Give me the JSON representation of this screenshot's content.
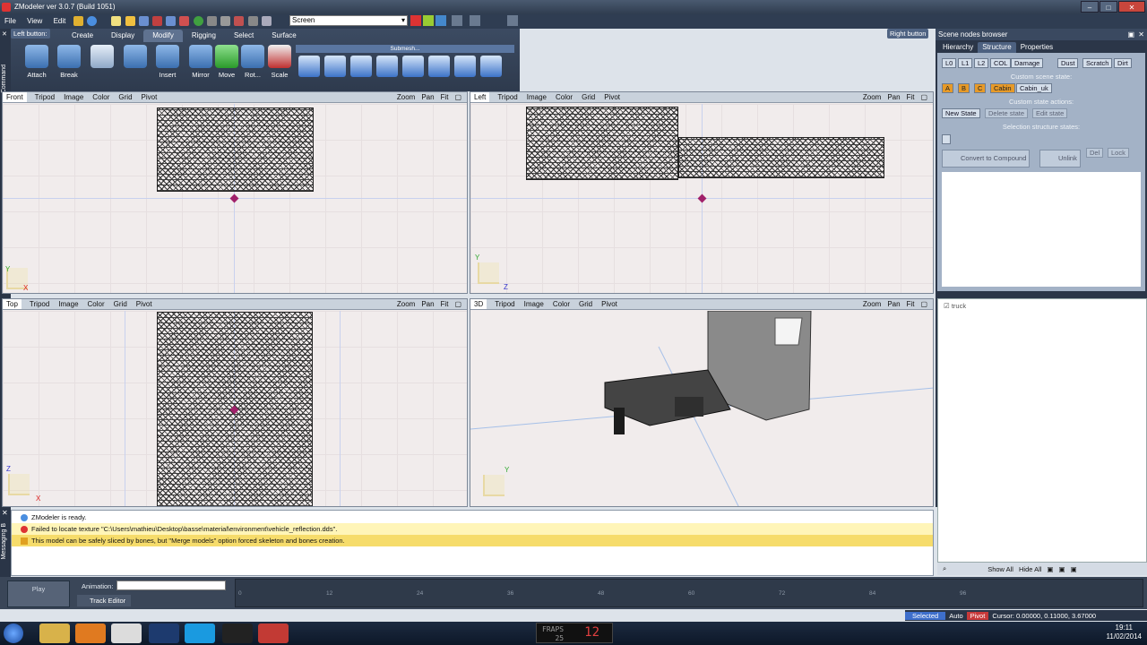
{
  "app": {
    "title": "ZModeler ver 3.0.7 (Build 1051)"
  },
  "menu": [
    "File",
    "View",
    "Edit"
  ],
  "toolbar": {
    "screen_select": "Screen"
  },
  "ribbon": {
    "left_button": "Left button:",
    "right_button": "Right button",
    "tabs": [
      "Create",
      "Display",
      "Modify",
      "Rigging",
      "Select",
      "Surface"
    ],
    "active_tab": "Modify",
    "tools": [
      "Attach",
      "Break",
      "",
      "",
      "Insert",
      "Mirror",
      "Move",
      "Rot...",
      "Scale"
    ],
    "submesh_label": "Submesh..."
  },
  "command_strip": {
    "label": "Command"
  },
  "messages_strip": {
    "label": "Messaging B"
  },
  "viewports": [
    {
      "name": "Front",
      "menu": [
        "Tripod",
        "Image",
        "Color",
        "Grid",
        "Pivot"
      ],
      "right": [
        "Zoom",
        "Pan",
        "Fit"
      ],
      "axes": [
        "Y",
        "X"
      ]
    },
    {
      "name": "Left",
      "menu": [
        "Tripod",
        "Image",
        "Color",
        "Grid",
        "Pivot"
      ],
      "right": [
        "Zoom",
        "Pan",
        "Fit"
      ],
      "axes": [
        "Y",
        "Z"
      ]
    },
    {
      "name": "Top",
      "menu": [
        "Tripod",
        "Image",
        "Color",
        "Grid",
        "Pivot"
      ],
      "right": [
        "Zoom",
        "Pan",
        "Fit"
      ],
      "axes": [
        "Z",
        "X"
      ]
    },
    {
      "name": "3D",
      "menu": [
        "Tripod",
        "Image",
        "Color",
        "Grid",
        "Pivot"
      ],
      "right": [
        "Zoom",
        "Pan",
        "Fit"
      ],
      "axes": [
        "Y",
        ""
      ]
    }
  ],
  "scene_panel": {
    "title": "Scene nodes browser",
    "tabs": [
      "Hierarchy",
      "Structure",
      "Properties"
    ],
    "active_tab": "Structure",
    "state_chips": [
      "L0",
      "L1",
      "L2",
      "COL",
      "Damage",
      "Dust",
      "Scratch",
      "Dirt"
    ],
    "ab_chips": [
      "A",
      "B",
      "C"
    ],
    "cabin_chips": [
      "Cabin",
      "Cabin_uk"
    ],
    "custom_scene_state": "Custom scene state:",
    "custom_state_actions": "Custom state actions:",
    "new_state": "New State",
    "delete_state": "Delete state",
    "edit_state": "Edit state",
    "selection_structure_states": "Selection structure states:",
    "convert_compound": "Convert to Compound",
    "unlink": "Unlink",
    "del": "Del",
    "lock": "Lock"
  },
  "nodes": {
    "root": "truck",
    "show_all": "Show All",
    "hide_all": "Hide All"
  },
  "log": [
    {
      "type": "info",
      "text": "ZModeler is ready."
    },
    {
      "type": "error",
      "text": "Failed to locate texture \"C:\\Users\\mathieu\\Desktop\\basse\\material\\environment\\vehicle_reflection.dds\"."
    },
    {
      "type": "warning",
      "text": "This model can be safely sliced by bones, but \"Merge models\" option forced skeleton and bones creation."
    }
  ],
  "timeline": {
    "play": "Play",
    "animation_label": "Animation:",
    "track_editor": "Track Editor",
    "ticks": [
      "0",
      "12",
      "24",
      "36",
      "48",
      "60",
      "72",
      "84",
      "96"
    ]
  },
  "status": {
    "selected": "Selected",
    "auto": "Auto",
    "pivot": "Pivot",
    "cursor": "Cursor: 0.00000, 0.11000, 3.67000"
  },
  "taskbar": {
    "time": "19:11",
    "date": "11/02/2014",
    "fps_label": "FRAPS",
    "fps": "25",
    "frame": "12"
  },
  "colors": {
    "titlebar": "#2f3c4f",
    "viewport_bg": "#f1ecec",
    "warning": "#f6dc6b",
    "accent": "#e79a28"
  }
}
